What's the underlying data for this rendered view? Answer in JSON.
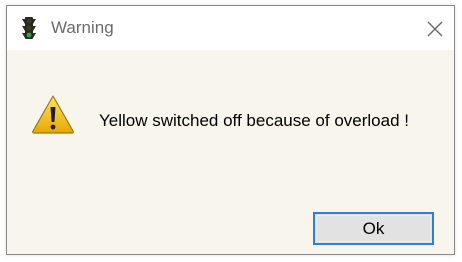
{
  "window": {
    "title": "Warning",
    "app_icon": "traffic-light-icon",
    "close_icon": "close-icon"
  },
  "dialog": {
    "icon": "warning-icon",
    "message": "Yellow switched off because of overload !",
    "ok_label": "Ok"
  },
  "colors": {
    "title_text": "#6b6b6b",
    "content_background": "#f8f6ec",
    "button_focus_border": "#2f7fd6",
    "button_background": "#e2e2e2",
    "warning_yellow": "#f2c200"
  }
}
